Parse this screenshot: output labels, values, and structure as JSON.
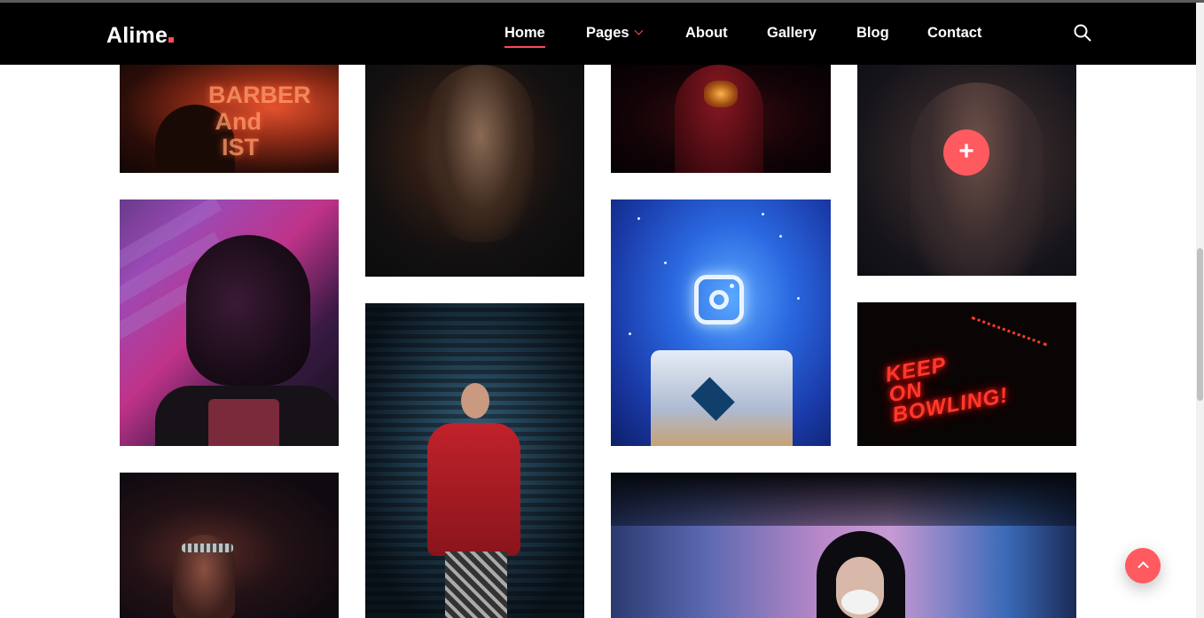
{
  "header": {
    "logo_text": "Alime",
    "logo_dot_color": "#ff4a57",
    "nav": [
      {
        "label": "Home",
        "active": true
      },
      {
        "label": "Pages",
        "has_dropdown": true
      },
      {
        "label": "About"
      },
      {
        "label": "Gallery"
      },
      {
        "label": "Blog"
      },
      {
        "label": "Contact"
      }
    ],
    "search_icon": "search-icon"
  },
  "gallery": {
    "tiles": [
      {
        "name": "barber-neon-photo",
        "neon_text": "BARBER\nAnd\nSTYLIST"
      },
      {
        "name": "painted-face-photo"
      },
      {
        "name": "red-hoodie-mask-photo"
      },
      {
        "name": "man-glasses-photo",
        "hovered": true
      },
      {
        "name": "purple-portrait-photo"
      },
      {
        "name": "red-jacket-girl-photo"
      },
      {
        "name": "instagram-bed-photo"
      },
      {
        "name": "keep-on-bowling-photo",
        "neon_text": "KEEP\nON\nBOWLING!"
      },
      {
        "name": "headband-portrait-photo"
      },
      {
        "name": "smoke-hoodie-photo"
      }
    ],
    "plus_label": "+"
  },
  "accent_color": "#ff5a5f",
  "scroll_top_icon": "chevron-up-icon"
}
